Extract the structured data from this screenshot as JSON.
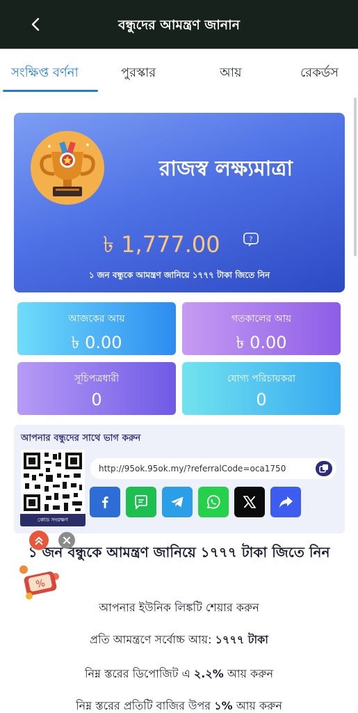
{
  "header": {
    "title": "বন্ধুদের আমন্ত্রণ জানান",
    "back_icon": "chevron-left-icon"
  },
  "tabs": [
    {
      "label": "সংক্ষিপ্ত বর্ণনা",
      "active": true
    },
    {
      "label": "পুরস্কার",
      "active": false
    },
    {
      "label": "আয়",
      "active": false
    },
    {
      "label": "রেকর্ডস",
      "active": false
    }
  ],
  "hero": {
    "title": "রাজস্ব লক্ষ্যমাত্রা",
    "amount": "৳ 1,777.00",
    "description": "১ জন বন্ধুকে আমন্ত্রণ জানিয়ে ১৭৭৭ টাকা জিতে নিন",
    "help_icon": "question-icon"
  },
  "stats": [
    {
      "label": "আজকের আয়",
      "value": "৳ 0.00"
    },
    {
      "label": "গতকালের আয়",
      "value": "৳ 0.00"
    },
    {
      "label": "সূচিপত্রধারী",
      "value": "0"
    },
    {
      "label": "যোগ্য পরিচায়করা",
      "value": "0"
    }
  ],
  "share": {
    "title": "আপনার বন্ধুদের সাথে ভাগ করুন",
    "qr_button": "কোড সংরক্ষণ",
    "link": "http://95ok.95ok.my/?referralCode=oca1750",
    "social": [
      "facebook-icon",
      "message-icon",
      "telegram-icon",
      "whatsapp-icon",
      "x-icon",
      "share-icon"
    ]
  },
  "info": {
    "title": "১ জন বন্ধুকে আমন্ত্রণ জানিয়ে ১৭৭৭ টাকা জিতে নিন",
    "line1": "আপনার ইউনিক লিঙ্কটি শেয়ার করুন",
    "line2_prefix": "প্রতি আমন্ত্রণে সর্বোচ্চ আয়: ",
    "line2_bold": "১৭৭৭ টাকা",
    "line3_prefix": "নিম্ন স্তরের ডিপোজিট এ ",
    "line3_bold": "২.২%",
    "line3_suffix": " আয় করুন",
    "line4_prefix": "নিম্ন স্তরের প্রতিটি বাজির উপর ",
    "line4_bold": "১%",
    "line4_suffix": " আয় করুন"
  },
  "colors": {
    "header_bg": "#17221c",
    "tab_active": "#1f7ed6",
    "amount": "#ffc877"
  }
}
